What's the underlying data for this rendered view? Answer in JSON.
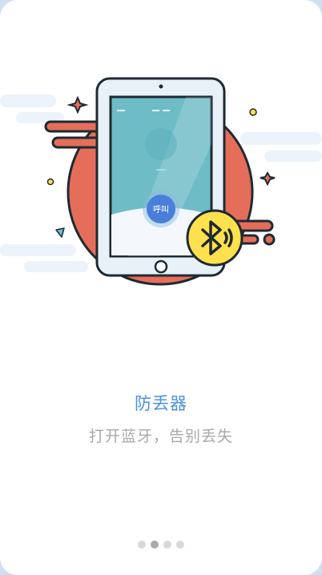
{
  "onboarding": {
    "title": "防丢器",
    "subtitle": "打开蓝牙，告别丢失",
    "call_button_label": "呼叫",
    "current_page": 2,
    "page_count": 4
  },
  "icons": {
    "bluetooth": "bluetooth-icon"
  },
  "colors": {
    "accent": "#4a90e2",
    "subtitle": "#a9a9a9",
    "circle": "#e56e5b",
    "badge": "#ffe14d",
    "outline": "#1e2a32"
  }
}
